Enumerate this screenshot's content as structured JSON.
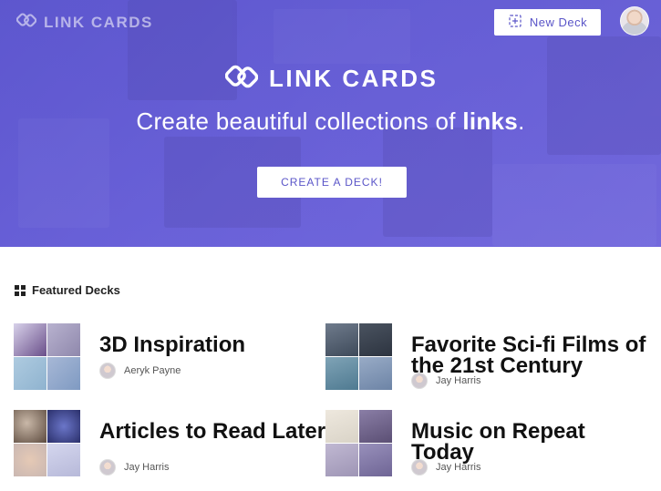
{
  "app": {
    "brand": "LINK CARDS",
    "new_deck_label": "New Deck",
    "hero_brand": "LINK CARDS",
    "tagline_prefix": "Create beautiful collections of ",
    "tagline_bold": "links",
    "tagline_suffix": ".",
    "create_button": "CREATE A DECK!"
  },
  "colors": {
    "accent": "#5a55c8",
    "hero_start": "#5b55c9",
    "hero_end": "#7b70dd"
  },
  "featured": {
    "heading": "Featured Decks",
    "decks": [
      {
        "title": "3D Inspiration",
        "author": "Aeryk Payne",
        "thumbs": [
          "#6a4f8a",
          "#b8b2cf",
          "#8fb3cf",
          "#7f9ac2"
        ]
      },
      {
        "title": "Favorite Sci-fi Films of the 21st Century",
        "author": "Jay Harris",
        "thumbs": [
          "#3e4a5a",
          "#2d3440",
          "#4f7a91",
          "#6d84a6"
        ]
      },
      {
        "title": "Articles to Read Later",
        "author": "Jay Harris",
        "thumbs": [
          "#5c4a3e",
          "#2a2f6a",
          "#c9b7b2",
          "#b7b9d9"
        ]
      },
      {
        "title": "Music on Repeat Today",
        "author": "Jay Harris",
        "thumbs": [
          "#d9d3c7",
          "#5b4f74",
          "#9e95b5",
          "#6f6595"
        ]
      }
    ]
  },
  "icons": {
    "logo": "link-cards-logo-icon",
    "add": "add-deck-icon",
    "featured": "grid-icon"
  }
}
